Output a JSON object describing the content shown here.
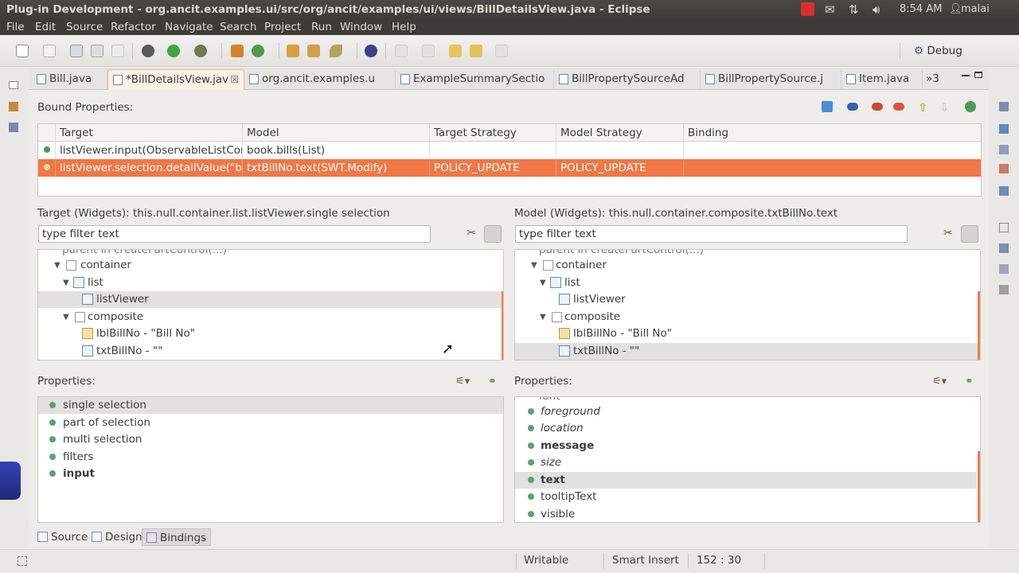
{
  "window": {
    "title": "Plug-in Development - org.ancit.examples.ui/src/org/ancit/examples/ui/views/BillDetailsView.java - Eclipse",
    "time": "8:54 AM",
    "user": "malai"
  },
  "menu": [
    "File",
    "Edit",
    "Source",
    "Refactor",
    "Navigate",
    "Search",
    "Project",
    "Run",
    "Window",
    "Help"
  ],
  "toolbar": {
    "perspective_label": "Debug"
  },
  "editor_tabs": [
    {
      "label": "Bill.java",
      "active": false
    },
    {
      "label": "*BillDetailsView.jav",
      "active": true
    },
    {
      "label": "org.ancit.examples.u",
      "active": false
    },
    {
      "label": "ExampleSummarySectio",
      "active": false
    },
    {
      "label": "BillPropertySourceAd",
      "active": false
    },
    {
      "label": "BillPropertySource.j",
      "active": false
    },
    {
      "label": "Item.java",
      "active": false
    }
  ],
  "tabs_overflow": "»3",
  "bound_properties": {
    "label": "Bound Properties:",
    "columns": [
      "Target",
      "Model",
      "Target Strategy",
      "Model Strategy",
      "Binding"
    ],
    "rows": [
      {
        "target": "listViewer.input(ObservableListContentProvider)",
        "model": "book.bills(List)",
        "target_strategy": "",
        "model_strategy": "",
        "binding": ""
      },
      {
        "target": "listViewer.selection.detailValue(\"billNo\")",
        "model": "txtBillNo.text(SWT.Modify)",
        "target_strategy": "POLICY_UPDATE",
        "model_strategy": "POLICY_UPDATE",
        "binding": ""
      }
    ]
  },
  "target_panel": {
    "label": "Target (Widgets): this.null.container.list.listViewer.single selection",
    "filter_placeholder": "type filter text",
    "tree": {
      "partial": "parent in createPartControl(...)",
      "container": "container",
      "list": "list",
      "listViewer": "listViewer",
      "composite": "composite",
      "lbl": "lblBillNo - \"Bill No\"",
      "txt": "txtBillNo - \"\""
    }
  },
  "model_panel": {
    "label": "Model (Widgets): this.null.container.composite.txtBillNo.text",
    "filter_placeholder": "type filter text",
    "tree": {
      "partial": "parent in createPartControl(...)",
      "container": "container",
      "list": "list",
      "listViewer": "listViewer",
      "composite": "composite",
      "lbl": "lblBillNo - \"Bill No\"",
      "txt": "txtBillNo - \"\""
    }
  },
  "target_properties": {
    "label": "Properties:",
    "items": [
      "single selection",
      "part of selection",
      "multi selection",
      "filters",
      "input"
    ]
  },
  "model_properties": {
    "label": "Properties:",
    "partial": "font",
    "items": [
      "foreground",
      "location",
      "message",
      "size",
      "text",
      "tooltipText",
      "visible"
    ]
  },
  "bottom_tabs": [
    "Source",
    "Design",
    "Bindings"
  ],
  "status": {
    "mode": "Writable",
    "insert": "Smart Insert",
    "position": "152 : 30"
  },
  "colors": {
    "selection": "#f07746",
    "accent": "#ef7c4f"
  }
}
